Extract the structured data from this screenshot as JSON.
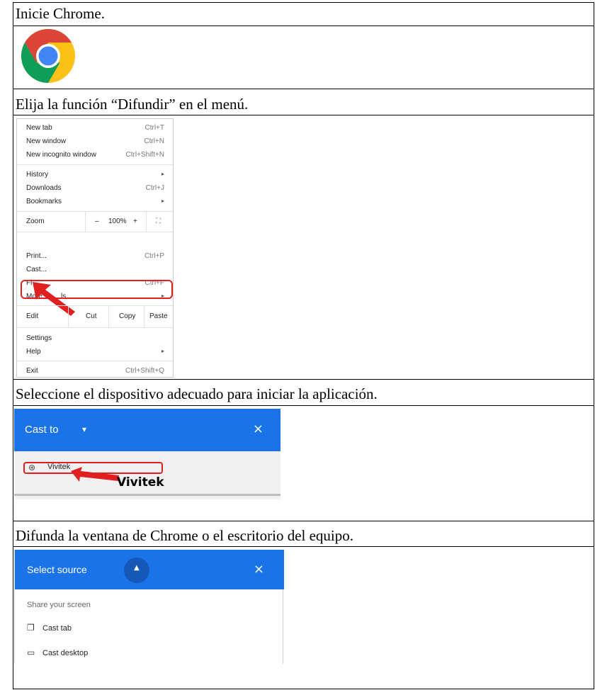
{
  "steps": [
    {
      "text": "Inicie Chrome."
    },
    {
      "text": "Elija la función “Difundir” en el menú."
    },
    {
      "text": "Seleccione el dispositivo adecuado para iniciar la aplicación."
    },
    {
      "text": "Difunda la ventana de Chrome o el escritorio del equipo."
    }
  ],
  "chrome_menu": {
    "items": [
      {
        "label": "New tab",
        "shortcut": "Ctrl+T"
      },
      {
        "label": "New window",
        "shortcut": "Ctrl+N"
      },
      {
        "label": "New incognito window",
        "shortcut": "Ctrl+Shift+N"
      },
      {
        "label": "History",
        "shortcut": "▸"
      },
      {
        "label": "Downloads",
        "shortcut": "Ctrl+J"
      },
      {
        "label": "Bookmarks",
        "shortcut": "▸"
      },
      {
        "label": "Print...",
        "shortcut": "Ctrl+P"
      },
      {
        "label": "Cast...",
        "shortcut": ""
      },
      {
        "label": "Fi",
        "shortcut": "Ctrl+F"
      },
      {
        "label": "More",
        "extra": "ls",
        "shortcut": "▸"
      },
      {
        "label": "Settings",
        "shortcut": ""
      },
      {
        "label": "Help",
        "shortcut": "▸"
      },
      {
        "label": "Exit",
        "shortcut": "Ctrl+Shift+Q"
      }
    ],
    "zoom": {
      "label": "Zoom",
      "minus": "–",
      "value": "100%",
      "plus": "+",
      "fullscreen": "⛶"
    },
    "edit": {
      "label": "Edit",
      "cut": "Cut",
      "copy": "Copy",
      "paste": "Paste"
    },
    "highlight_color": "#e02020"
  },
  "cast_panel": {
    "title": "Cast to",
    "dropdown": "▾",
    "close": "×",
    "device": "Vivitek",
    "callout": "Vivitek",
    "header_color": "#1a73e8"
  },
  "source_panel": {
    "title": "Select source",
    "toggle": "▲",
    "close": "×",
    "subtitle": "Share your screen",
    "options": [
      {
        "icon": "tab-icon",
        "label": "Cast tab"
      },
      {
        "icon": "laptop-icon",
        "label": "Cast desktop"
      }
    ],
    "header_color": "#1a73e8"
  }
}
